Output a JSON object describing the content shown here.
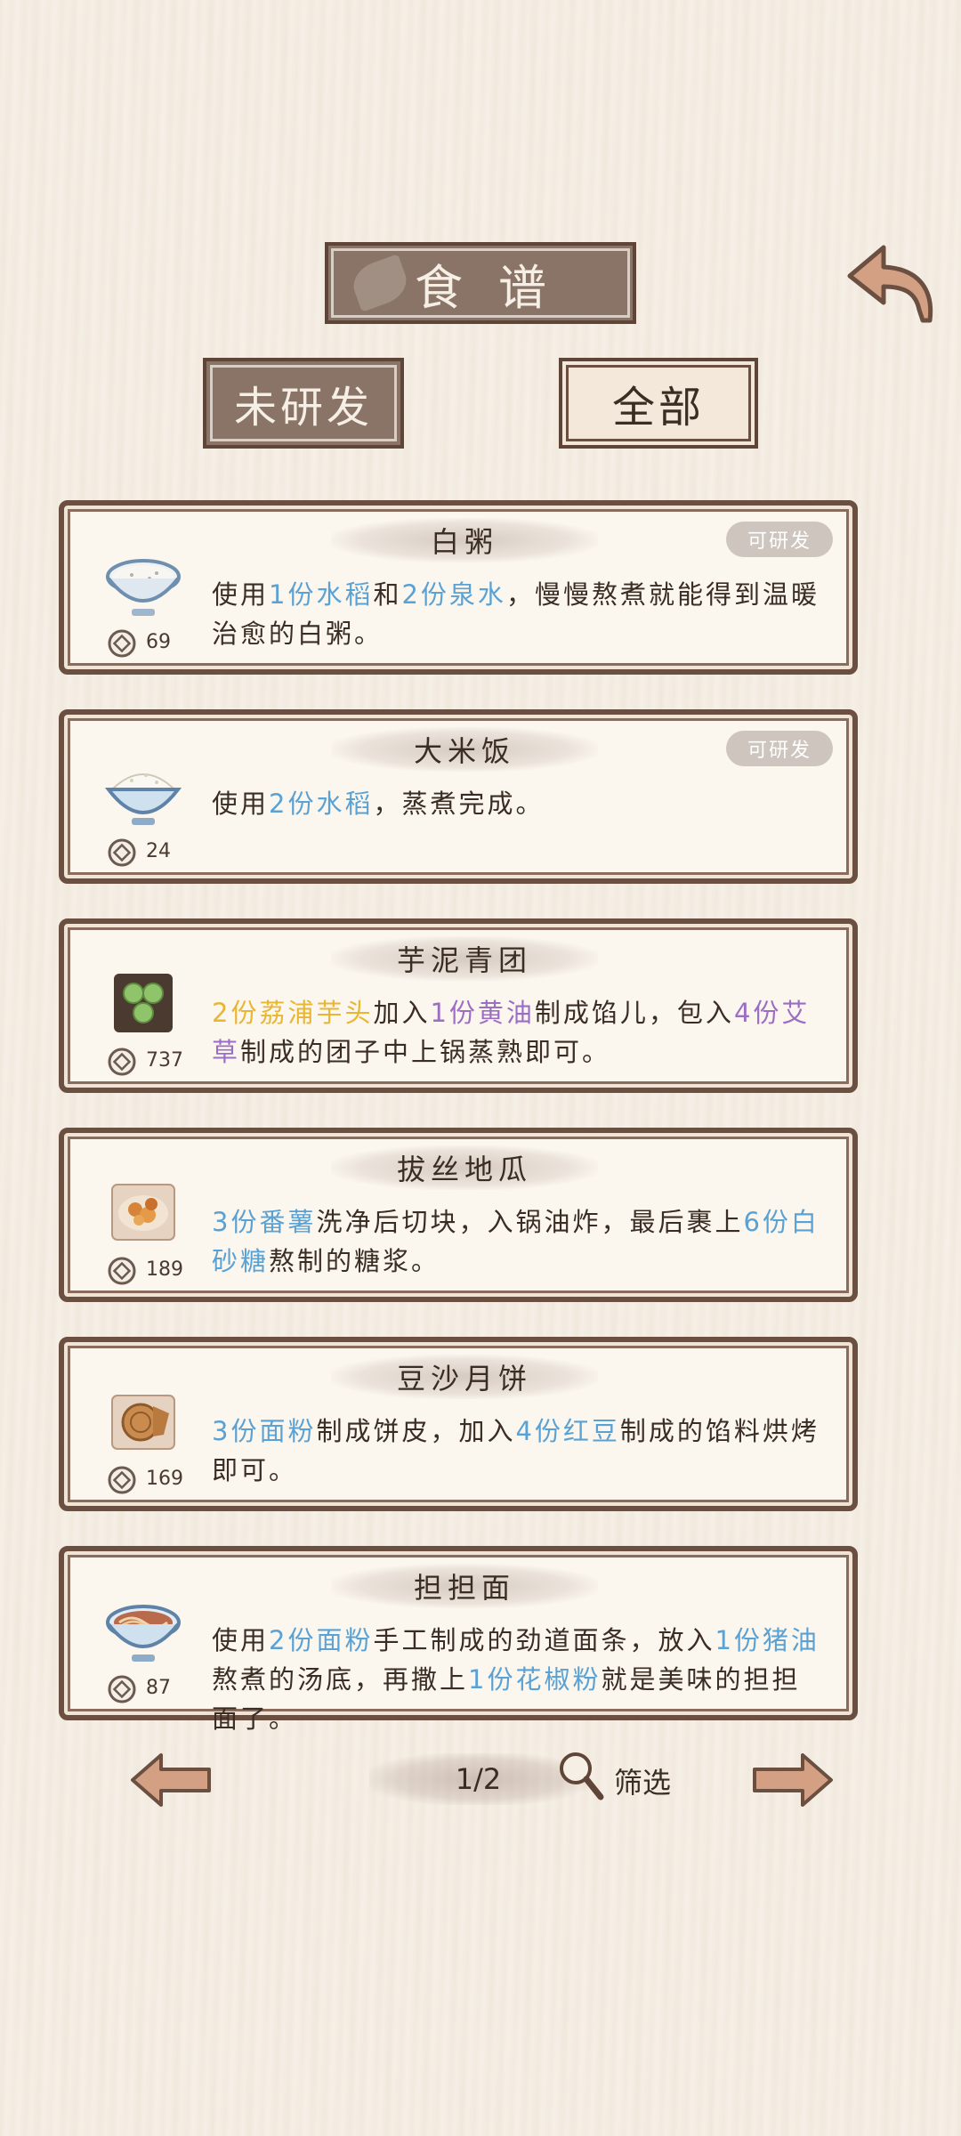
{
  "header": {
    "title": "食谱",
    "back_icon": "back-arrow-icon"
  },
  "tabs": [
    {
      "label": "未研发",
      "active": false
    },
    {
      "label": "全部",
      "active": true
    }
  ],
  "recipes": [
    {
      "name": "白粥",
      "badge": "可研发",
      "price": "69",
      "icon": "rice-porridge-bowl",
      "desc": [
        {
          "t": "使用",
          "c": ""
        },
        {
          "t": "1份水稻",
          "c": "blue"
        },
        {
          "t": "和",
          "c": ""
        },
        {
          "t": "2份泉水",
          "c": "blue"
        },
        {
          "t": "，慢慢熬煮就能得到温暖治愈的白粥。",
          "c": ""
        }
      ]
    },
    {
      "name": "大米饭",
      "badge": "可研发",
      "price": "24",
      "icon": "rice-bowl",
      "desc": [
        {
          "t": "使用",
          "c": ""
        },
        {
          "t": "2份水稻",
          "c": "blue"
        },
        {
          "t": "，蒸煮完成。",
          "c": ""
        }
      ]
    },
    {
      "name": "芋泥青团",
      "badge": "",
      "price": "737",
      "icon": "green-rice-balls",
      "desc": [
        {
          "t": "2份荔浦芋头",
          "c": "yellow"
        },
        {
          "t": "加入",
          "c": ""
        },
        {
          "t": "1份黄油",
          "c": "purple"
        },
        {
          "t": "制成馅儿，包入",
          "c": ""
        },
        {
          "t": "4份艾草",
          "c": "purple"
        },
        {
          "t": "制成的团子中上锅蒸熟即可。",
          "c": ""
        }
      ]
    },
    {
      "name": "拔丝地瓜",
      "badge": "",
      "price": "189",
      "icon": "candied-sweet-potato",
      "desc": [
        {
          "t": "3份番薯",
          "c": "blue"
        },
        {
          "t": "洗净后切块，入锅油炸，最后裹上",
          "c": ""
        },
        {
          "t": "6份白砂糖",
          "c": "blue"
        },
        {
          "t": "熬制的糖浆。",
          "c": ""
        }
      ]
    },
    {
      "name": "豆沙月饼",
      "badge": "",
      "price": "169",
      "icon": "mooncake",
      "desc": [
        {
          "t": "3份面粉",
          "c": "blue"
        },
        {
          "t": "制成饼皮，加入",
          "c": ""
        },
        {
          "t": "4份红豆",
          "c": "blue"
        },
        {
          "t": "制成的馅料烘烤即可。",
          "c": ""
        }
      ]
    },
    {
      "name": "担担面",
      "badge": "",
      "price": "87",
      "icon": "dandan-noodles",
      "desc": [
        {
          "t": "使用",
          "c": ""
        },
        {
          "t": "2份面粉",
          "c": "blue"
        },
        {
          "t": "手工制成的劲道面条，放入",
          "c": ""
        },
        {
          "t": "1份猪油",
          "c": "blue"
        },
        {
          "t": "熬煮的汤底，再撒上",
          "c": ""
        },
        {
          "t": "1份花椒粉",
          "c": "blue"
        },
        {
          "t": "就是美味的担担面了。",
          "c": ""
        }
      ]
    }
  ],
  "pager": {
    "page": "1/2",
    "filter_label": "筛选"
  },
  "colors": {
    "accent_dark": "#8a7468",
    "border": "#6b4f41",
    "highlight_blue": "#5aa1d4",
    "highlight_yellow": "#e8b631",
    "highlight_purple": "#9b6dc4"
  }
}
